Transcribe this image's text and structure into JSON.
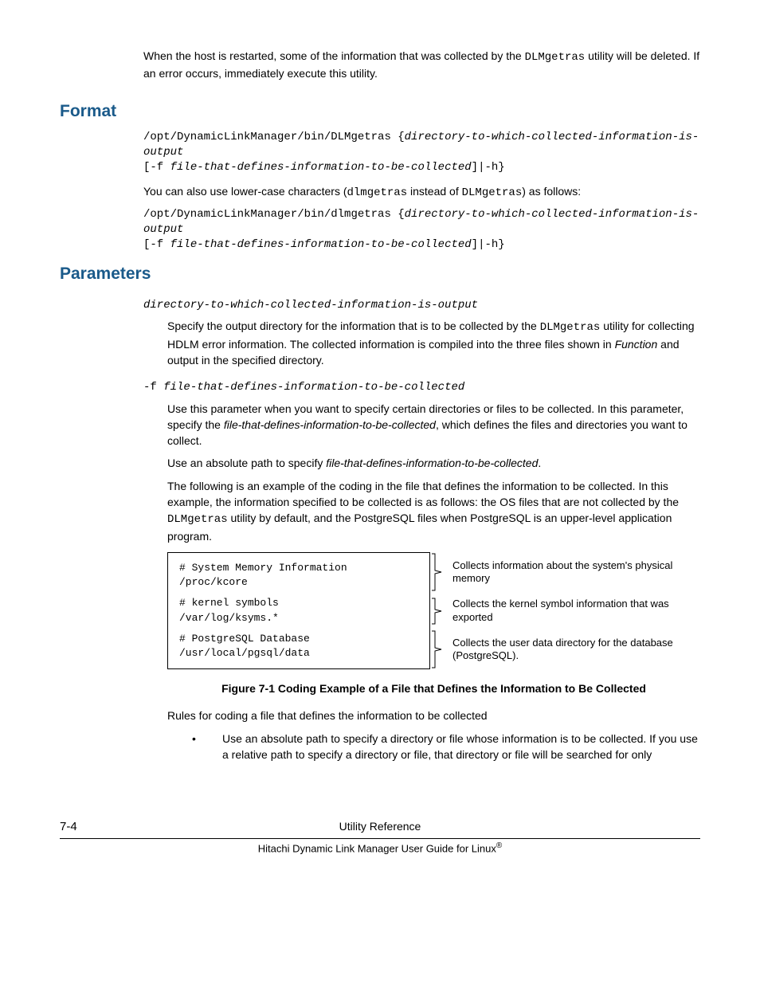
{
  "intro": {
    "p1_a": "When the host is restarted, some of the information that was collected by the ",
    "p1_code": "DLMgetras",
    "p1_b": " utility will be deleted. If an error occurs, immediately execute this utility."
  },
  "format": {
    "heading": "Format",
    "code1_a": "/opt/DynamicLinkManager/bin/DLMgetras {",
    "code1_b": "directory-to-which-collected-information-is-output",
    "code1_c": "[-f ",
    "code1_d": "file-that-defines-information-to-be-collected",
    "code1_e": "]|-h}",
    "mid_a": "You can also use lower-case characters (",
    "mid_code1": "dlmgetras",
    "mid_b": " instead of ",
    "mid_code2": "DLMgetras",
    "mid_c": ") as follows:",
    "code2_a": "/opt/DynamicLinkManager/bin/dlmgetras {",
    "code2_b": "directory-to-which-collected-information-is-output",
    "code2_c": "[-f ",
    "code2_d": "file-that-defines-information-to-be-collected",
    "code2_e": "]|-h}"
  },
  "params": {
    "heading": "Parameters",
    "p1_term": "directory-to-which-collected-information-is-output",
    "p1_desc_a": "Specify the output directory for the information that is to be collected by the ",
    "p1_desc_code": "DLMgetras",
    "p1_desc_b": " utility for collecting HDLM error information. The collected information is compiled into the three files shown in ",
    "p1_desc_i": "Function",
    "p1_desc_c": " and output in the specified directory.",
    "p2_pre": "-f ",
    "p2_term": "file-that-defines-information-to-be-collected",
    "p2_d1_a": "Use this parameter when you want to specify certain directories or files to be collected. In this parameter, specify the ",
    "p2_d1_i": "file-that-defines-information-to-be-collected",
    "p2_d1_b": ", which defines the files and directories you want to collect.",
    "p2_d2_a": "Use an absolute path to specify ",
    "p2_d2_i": "file-that-defines-information-to-be-collected",
    "p2_d2_b": ".",
    "p2_d3_a": "The following is an example of the coding in the file that defines the information to be collected. In this example, the information specified to be collected is as follows: the OS files that are not collected by the ",
    "p2_d3_code": "DLMgetras",
    "p2_d3_b": " utility by default, and the PostgreSQL files when PostgreSQL is an upper-level application program.",
    "fig_c1_l1": "# System Memory Information",
    "fig_c1_l2": "/proc/kcore",
    "fig_c2_l1": "# kernel symbols",
    "fig_c2_l2": "/var/log/ksyms.*",
    "fig_c3_l1": "# PostgreSQL Database",
    "fig_c3_l2": "/usr/local/pgsql/data",
    "annot1": "Collects information about the system's physical memory",
    "annot2": "Collects the kernel symbol information that was exported",
    "annot3": "Collects the user data directory for the database (PostgreSQL).",
    "fig_caption": "Figure 7-1 Coding Example of a File that Defines the Information to Be Collected",
    "rules_intro": "Rules for coding a file that defines the information to be collected",
    "bullet1": "Use an absolute path to specify a directory or file whose information is to be collected. If you use a relative path to specify a directory or file, that directory or file will be searched for only"
  },
  "footer": {
    "page": "7-4",
    "line1": "Utility Reference",
    "line2_a": "Hitachi Dynamic Link Manager User Guide for Linux",
    "line2_b": "®"
  }
}
